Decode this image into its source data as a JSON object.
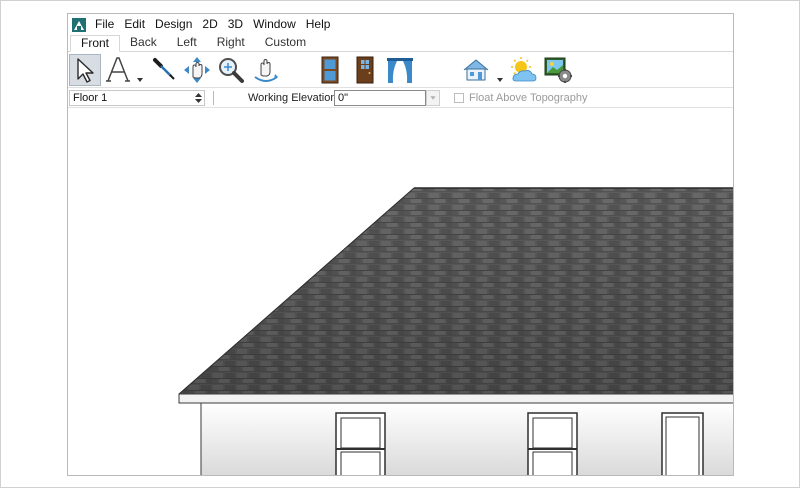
{
  "menubar": {
    "items": [
      "File",
      "Edit",
      "Design",
      "2D",
      "3D",
      "Window",
      "Help"
    ]
  },
  "tabs": {
    "items": [
      "Front",
      "Back",
      "Left",
      "Right",
      "Custom"
    ],
    "active": "Front"
  },
  "toolbar": {
    "tools": [
      {
        "name": "select-objects-icon",
        "selected": true
      },
      {
        "name": "text-tool-icon",
        "dropdown": true
      },
      {
        "name": "eyedropper-icon"
      },
      {
        "name": "pan-move-icon"
      },
      {
        "name": "zoom-icon"
      },
      {
        "name": "orbit-hand-icon"
      },
      {
        "name": "door-icon"
      },
      {
        "name": "window-icon"
      },
      {
        "name": "curtain-icon"
      },
      {
        "name": "house-icon",
        "dropdown": true
      },
      {
        "name": "sun-weather-icon"
      },
      {
        "name": "picture-settings-icon"
      }
    ]
  },
  "options": {
    "floor": "Floor 1",
    "working_elevation_label": "Working Elevation:",
    "working_elevation_value": "0\"",
    "float_above_topography_label": "Float Above Topography",
    "float_above_topography_checked": false
  },
  "colors": {
    "roof": "#5f5f5f",
    "roof_dark": "#4a4a4a",
    "wall_top": "#ffffff",
    "wall_bottom": "#d8d8d8",
    "selection": "#d7dde3",
    "logo": "#1f6f73"
  }
}
